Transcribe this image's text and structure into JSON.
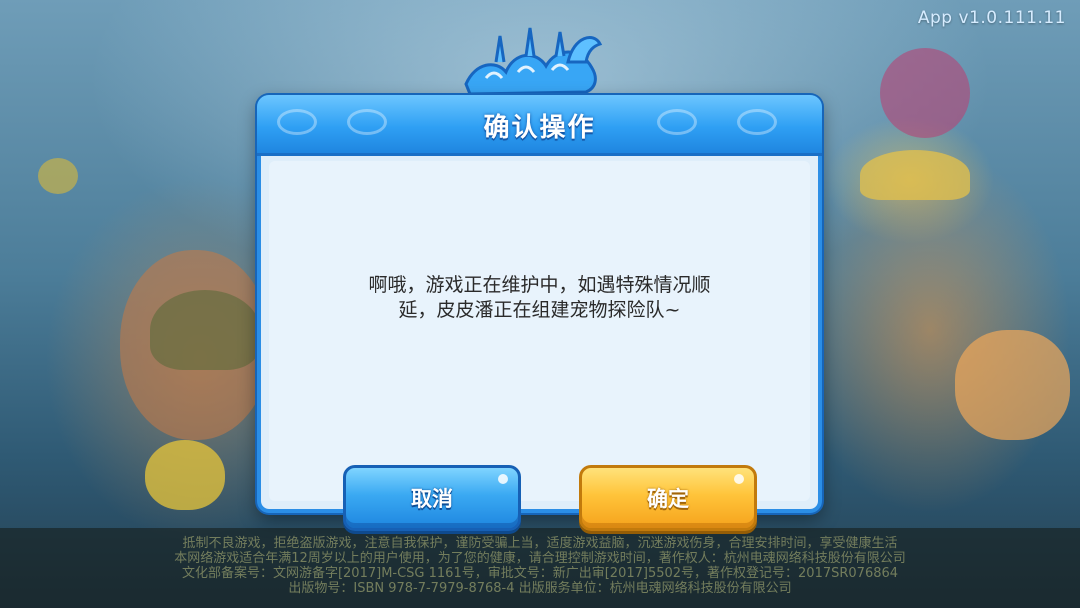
{
  "app": {
    "version_label": "App  v1.0.111.11"
  },
  "dialog": {
    "title": "确认操作",
    "message_line1": "啊哦，游戏正在维护中，如遇特殊情况顺",
    "message_line2": "延，皮皮潘正在组建宠物探险队~",
    "cancel_label": "取消",
    "confirm_label": "确定"
  },
  "footer": {
    "line1": "抵制不良游戏，拒绝盗版游戏，注意自我保护，谨防受骗上当，适度游戏益脑，沉迷游戏伤身，合理安排时间，享受健康生活",
    "line2": "本网络游戏适合年满12周岁以上的用户使用，为了您的健康，请合理控制游戏时间，著作权人：杭州电魂网络科技股份有限公司",
    "line3": "文化部备案号：文网游备字[2017]M-CSG 1161号，审批文号：新广出审[2017]5502号，著作权登记号：2017SR076864",
    "line4": "出版物号：ISBN 978-7-7979-8768-4   出版服务单位：杭州电魂网络科技股份有限公司"
  },
  "colors": {
    "dialog_border": "#2b8ee6",
    "cancel_button": "#3aa9f2",
    "confirm_button": "#ffc43a"
  }
}
